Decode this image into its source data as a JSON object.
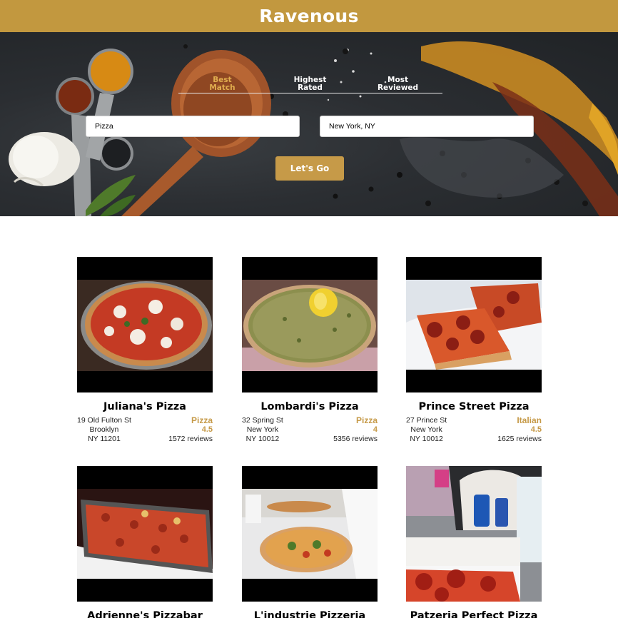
{
  "brand": {
    "title": "Ravenous",
    "color": "#c2983f"
  },
  "search": {
    "sort_options": [
      {
        "label_line1": "Best",
        "label_line2": "Match",
        "active": true
      },
      {
        "label_line1": "Highest",
        "label_line2": "Rated",
        "active": false
      },
      {
        "label_line1": "Most",
        "label_line2": "Reviewed",
        "active": false
      }
    ],
    "term_value": "Pizza",
    "location_value": "New York, NY",
    "submit_label": "Let's Go"
  },
  "businesses": [
    {
      "name": "Juliana's Pizza",
      "address": "19 Old Fulton St",
      "city": "Brooklyn",
      "state_zip": "NY 11201",
      "category": "Pizza",
      "rating": "4.5",
      "reviews": "1572 reviews",
      "image": "margherita-pizza"
    },
    {
      "name": "Lombardi's Pizza",
      "address": "32 Spring St",
      "city": "New York",
      "state_zip": "NY 10012",
      "category": "Pizza",
      "rating": "4",
      "reviews": "5356 reviews",
      "image": "pesto-pizza-lemon"
    },
    {
      "name": "Prince Street Pizza",
      "address": "27 Prince St",
      "city": "New York",
      "state_zip": "NY 10012",
      "category": "Italian",
      "rating": "4.5",
      "reviews": "1625 reviews",
      "image": "pepperoni-square-slices"
    },
    {
      "name": "Adrienne's Pizzabar",
      "image": "sheet-pan-pizza"
    },
    {
      "name": "L'industrie Pizzeria",
      "image": "chef-pizza"
    },
    {
      "name": "Patzeria Perfect Pizza",
      "image": "times-square-slice"
    }
  ]
}
